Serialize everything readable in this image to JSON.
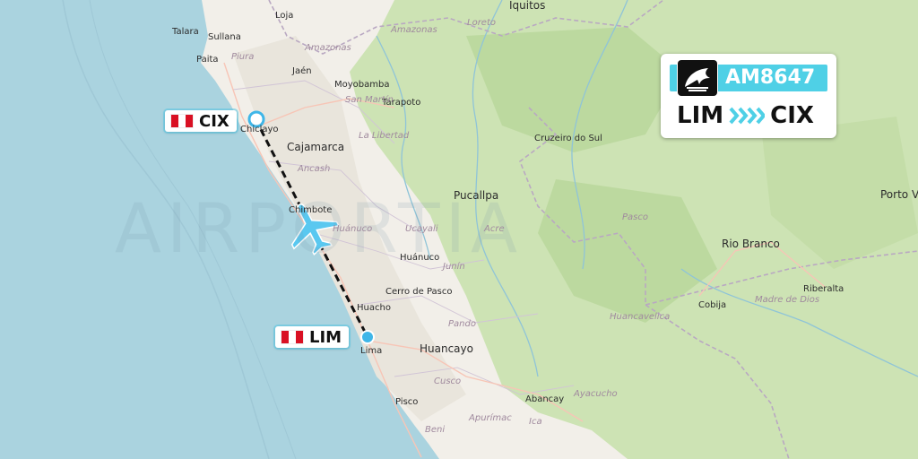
{
  "flight": {
    "number": "AM8647",
    "origin_code": "LIM",
    "destination_code": "CIX",
    "airline_logo": "aeromexico-eagle-logo",
    "accent_color": "#4fd0e6"
  },
  "origin_airport": {
    "code": "LIM",
    "flag": "peru-flag"
  },
  "destination_airport": {
    "code": "CIX",
    "flag": "peru-flag"
  },
  "watermark": "AIRPORTIA",
  "map_labels": {
    "cities": [
      "Iquitos",
      "Loja",
      "Talara",
      "Sullana",
      "Paita",
      "Jaén",
      "Moyobamba",
      "Tarapoto",
      "Chiclayo",
      "Cajamarca",
      "Cruzeiro do Sul",
      "Pucallpa",
      "Chimbote",
      "Huánuco",
      "Rio Branco",
      "Porto Velho",
      "Cerro de Pasco",
      "Huacho",
      "Lima",
      "Huancayo",
      "Cobija",
      "Riberalta",
      "Abancay",
      "Pisco"
    ],
    "regions": [
      "Loreto",
      "Amazonas",
      "Piura",
      "Amazonas",
      "San Martín",
      "La Libertad",
      "Ancash",
      "Huánuco",
      "Ucayali",
      "Acre",
      "Pasco",
      "Junín",
      "Pando",
      "Madre de Dios",
      "Huancavelica",
      "Cusco",
      "Ayacucho",
      "Apurímac",
      "Ica",
      "Beni"
    ]
  },
  "colors": {
    "ocean": "#aad3df",
    "land": "#f2efe9",
    "forest": "#cde3b4",
    "peru_red": "#d91023",
    "route_line": "#111111",
    "plane": "#3fb6e8"
  }
}
